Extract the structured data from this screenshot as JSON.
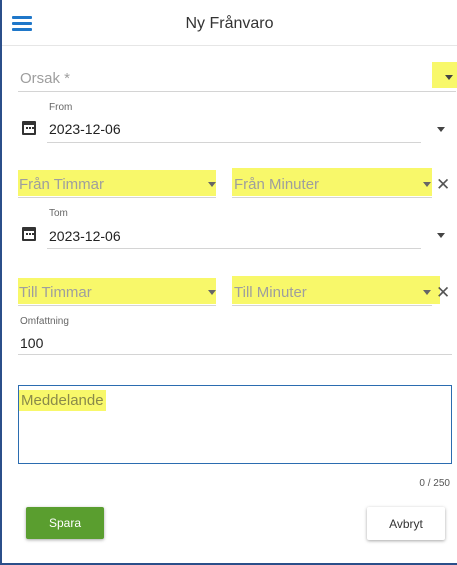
{
  "header": {
    "title": "Ny Frånvaro",
    "menu_icon": "hamburger-menu-icon"
  },
  "reason": {
    "placeholder": "Orsak *"
  },
  "from": {
    "label": "From",
    "date": "2023-12-06",
    "hours_placeholder": "Från Timmar",
    "minutes_placeholder": "Från Minuter"
  },
  "to": {
    "label": "Tom",
    "date": "2023-12-06",
    "hours_placeholder": "Till Timmar",
    "minutes_placeholder": "Till Minuter"
  },
  "scope": {
    "label": "Omfattning",
    "value": "100"
  },
  "message": {
    "placeholder": "Meddelande",
    "counter": "0 / 250"
  },
  "actions": {
    "save_label": "Spara",
    "cancel_label": "Avbryt"
  },
  "colors": {
    "accent": "#1f77c9",
    "save_button": "#5a9e2f",
    "highlight": "#f8f86a"
  }
}
